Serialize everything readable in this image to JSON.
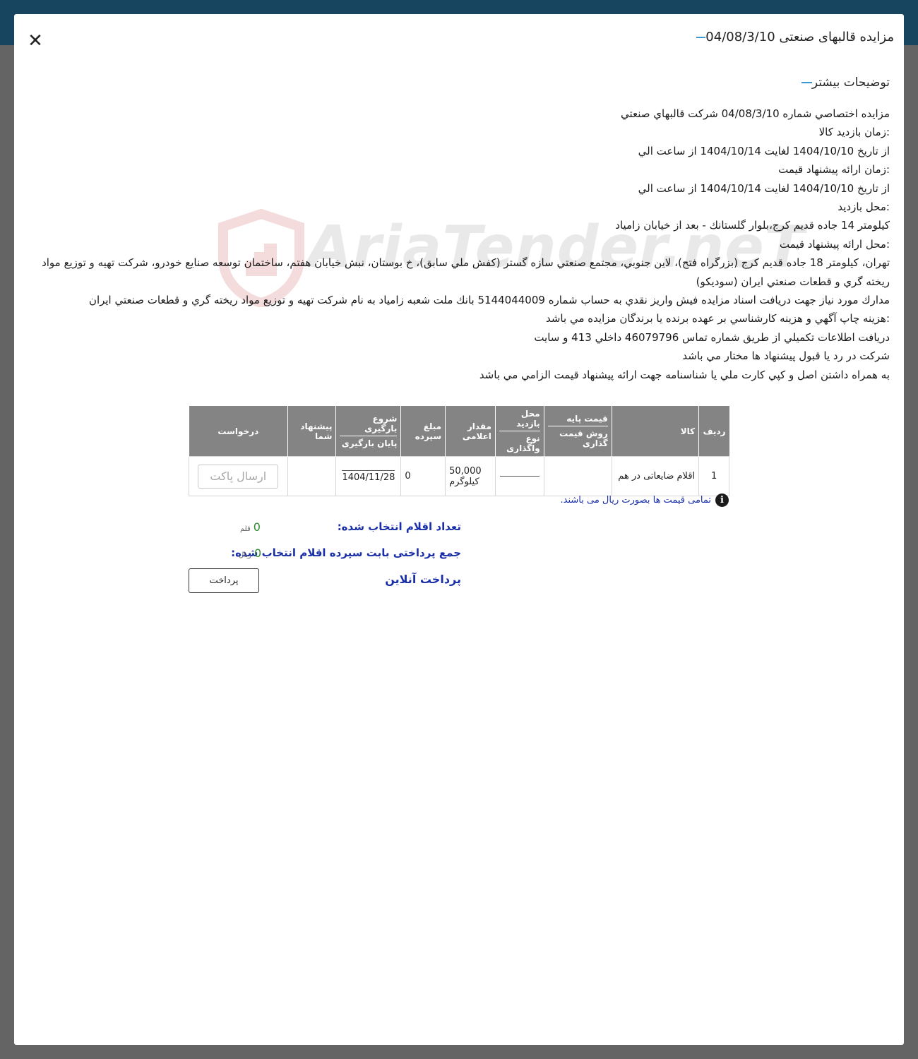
{
  "modal": {
    "title": "مزایده قالبهای صنعتی 04/08/3/10",
    "section_title": "توضیحات بیشتر"
  },
  "description": [
    "مزايده اختصاصي شماره 04/08/3/10 شركت قالبهاي صنعتي",
    ":زمان بازديد كالا",
    "از تاريخ 1404/10/10 لغايت 1404/10/14 از ساعت الي",
    ":زمان ارائه پيشنهاد قيمت",
    "از تاريخ 1404/10/10 لغايت 1404/10/14 از ساعت الي",
    ":محل بازديد",
    "كيلومتر 14 جاده قديم كرج،بلوار گلستانك - بعد از خيابان زامياد",
    ":محل ارائه پيشنهاد قيمت",
    "تهران، كيلومتر 18 جاده قديم كرج (بزرگراه فتح)، لاين جنوبي، مجتمع صنعتي سازه گستر (كفش ملي سابق)، خ بوستان، نبش خيابان هفتم، ساختمان توسعه صنايع خودرو، شركت تهيه و توزيع مواد ريخته گري و قطعات صنعتي ايران (سوديكو)",
    "مدارك مورد نياز جهت دريافت اسناد مزايده فيش واريز نقدي به حساب شماره 5144044009 بانك ملت شعبه زامياد به نام شركت تهيه و توزيع مواد ريخته گري و قطعات صنعتي ايران",
    ":هزينه چاپ آگهي و هزينه كارشناسي بر عهده برنده يا برندگان مزايده مي باشد",
    "دريافت اطلاعات تكميلي از طريق شماره تماس 46079796 داخلي 413 و سايت",
    "شركت در رد يا قبول پيشنهاد ها مختار مي باشد",
    "به همراه داشتن اصل و كپي كارت ملي يا شناسنامه جهت ارائه پيشنهاد قيمت الزامي مي باشد"
  ],
  "watermark": "AriaTender.neT",
  "table": {
    "headers": {
      "row": "ردیف",
      "item": "کالا",
      "base_price": "قیمت پایه",
      "pricing_method": "روش قیمت گذاری",
      "visit_place": "محل بازدید",
      "transfer_type": "نوع واگذاری",
      "quantity": "مقدار اعلامی",
      "deposit": "مبلغ سپرده",
      "load_start": "شروع بارگیری",
      "load_end": "پایان بارگیری",
      "your_offer": "پیشنهاد شما",
      "request": "درخواست"
    },
    "rows": [
      {
        "row": "1",
        "item": "اقلام ضایعاتی در هم",
        "base_price": "",
        "quantity_value": "50,000",
        "quantity_unit": "کیلوگرم",
        "deposit": "0",
        "load_end": "1404/11/28",
        "your_offer": "",
        "request_button": "ارسال پاکت"
      }
    ]
  },
  "note": "تمامی قیمت ها بصورت ریال می باشند.",
  "summary": {
    "selected_count_label": "تعداد اقلام انتخاب شده:",
    "selected_count_value": "0",
    "selected_count_unit": "قلم",
    "total_payment_label": "جمع پرداختی بابت سپرده اقلام انتخاب شده:",
    "total_payment_value": "0",
    "total_payment_unit": "ریال",
    "online_payment_label": "پرداخت آنلاین",
    "pay_button": "پرداخت"
  },
  "colors": {
    "topbar": "#17445e",
    "accent_dash": "#3b97d3",
    "header_bg": "#848484",
    "link_blue": "#1a2ea8",
    "value_green": "#2e8b2e"
  }
}
